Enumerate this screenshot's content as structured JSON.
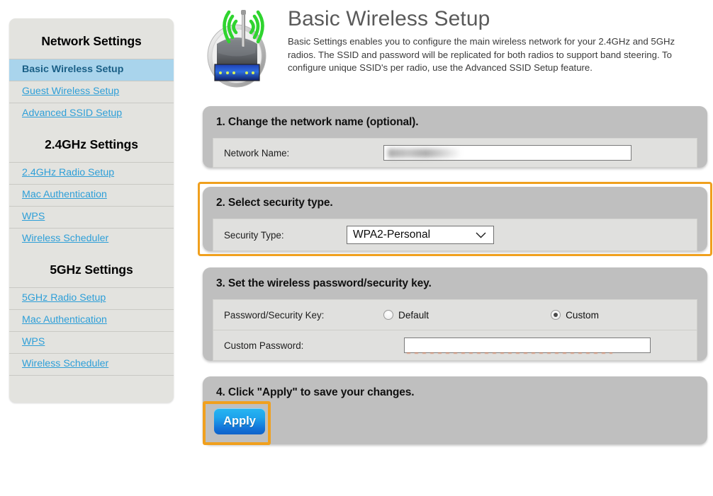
{
  "sidebar": {
    "groups": [
      {
        "title": "Network Settings",
        "items": [
          {
            "label": "Basic Wireless Setup",
            "active": true
          },
          {
            "label": "Guest Wireless Setup",
            "active": false
          },
          {
            "label": "Advanced SSID Setup",
            "active": false
          }
        ]
      },
      {
        "title": "2.4GHz Settings",
        "items": [
          {
            "label": "2.4GHz Radio Setup",
            "active": false
          },
          {
            "label": "Mac Authentication",
            "active": false
          },
          {
            "label": "WPS",
            "active": false
          },
          {
            "label": "Wireless Scheduler",
            "active": false
          }
        ]
      },
      {
        "title": "5GHz Settings",
        "items": [
          {
            "label": "5GHz Radio Setup",
            "active": false
          },
          {
            "label": "Mac Authentication",
            "active": false
          },
          {
            "label": "WPS",
            "active": false
          },
          {
            "label": "Wireless Scheduler",
            "active": false
          }
        ]
      }
    ]
  },
  "header": {
    "icon": "wireless-router-icon",
    "title": "Basic Wireless Setup",
    "description": "Basic Settings enables you to configure the main wireless network for your 2.4GHz and 5GHz radios. The SSID and password will be replicated for both radios to support band steering. To configure unique SSID's per radio, use the Advanced SSID Setup feature."
  },
  "sections": {
    "step1": {
      "heading": "1. Change the network name (optional).",
      "network_name_label": "Network Name:",
      "network_name_value": "",
      "network_name_redacted": true
    },
    "step2": {
      "heading": "2. Select security type.",
      "security_type_label": "Security Type:",
      "security_type_value": "WPA2-Personal",
      "security_type_options": [
        "WPA2-Personal"
      ],
      "highlighted": true
    },
    "step3": {
      "heading": "3. Set the wireless password/security key.",
      "password_mode_label": "Password/Security Key:",
      "radio_default_label": "Default",
      "radio_custom_label": "Custom",
      "selected_mode": "Custom",
      "custom_password_label": "Custom Password:",
      "custom_password_value": "",
      "custom_password_redacted": true
    },
    "step4": {
      "heading": "4. Click \"Apply\" to save your changes.",
      "apply_label": "Apply",
      "highlighted": true
    }
  },
  "colors": {
    "highlight": "#f0a01e",
    "panel_header": "#bfbfbf",
    "panel_body": "#e0e0de",
    "sidebar": "#e3e3df",
    "sidebar_active": "#a9d4ec",
    "link": "#2e9fd8",
    "apply_button": "#1ea3ec"
  }
}
